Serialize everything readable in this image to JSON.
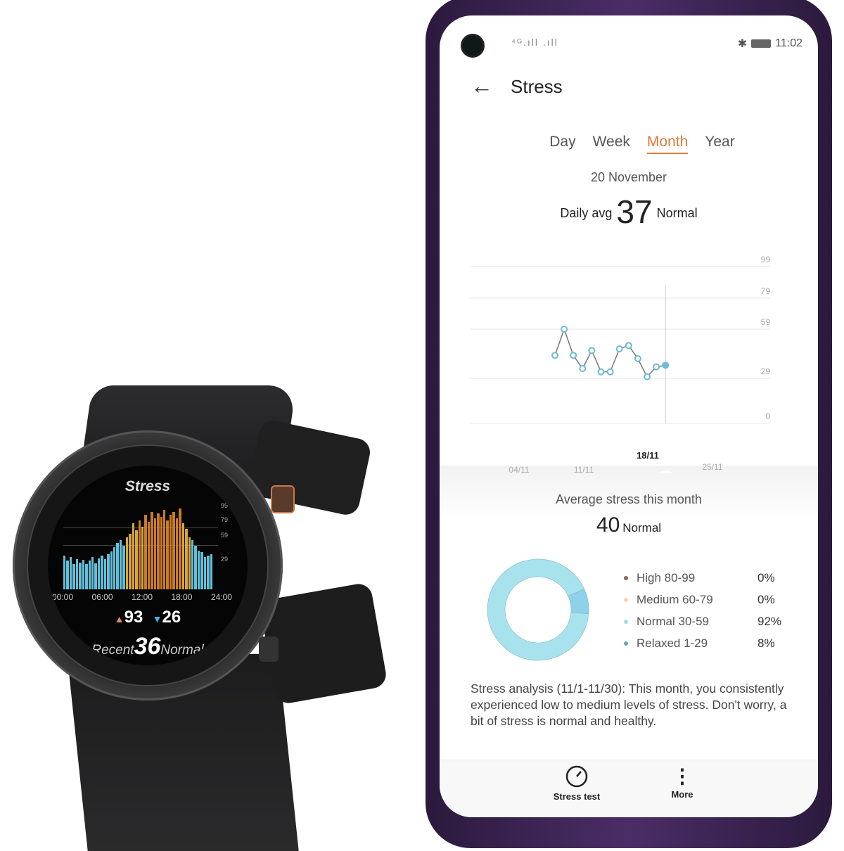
{
  "watch": {
    "title": "Stress",
    "y_labels": [
      "99",
      "79",
      "59",
      "29"
    ],
    "x_labels": [
      "00:00",
      "06:00",
      "12:00",
      "18:00",
      "24:00"
    ],
    "max": "93",
    "min": "26",
    "recent_label": "Recent",
    "recent_value": "36",
    "recent_level": "Normal",
    "bars": [
      40,
      34,
      38,
      30,
      36,
      32,
      35,
      30,
      34,
      38,
      31,
      37,
      40,
      36,
      42,
      45,
      50,
      55,
      58,
      52,
      62,
      66,
      78,
      70,
      82,
      74,
      88,
      80,
      92,
      84,
      90,
      86,
      94,
      82,
      88,
      92,
      84,
      96,
      78,
      72,
      62,
      58,
      52,
      46,
      44,
      38,
      40,
      42
    ],
    "colors": {
      "relaxed": "#2aa8e0",
      "normal": "#6fd3ee",
      "medium": "#f0b840",
      "high": "#e0882a"
    }
  },
  "status_bar": {
    "signal": "⁴ᴳ.ıll .ıll",
    "time": "11:02"
  },
  "header": {
    "title": "Stress"
  },
  "tabs": [
    {
      "label": "Day"
    },
    {
      "label": "Week"
    },
    {
      "label": "Month",
      "active": true
    },
    {
      "label": "Year"
    }
  ],
  "summary": {
    "date": "20 November",
    "label": "Daily avg",
    "value": "37",
    "level": "Normal"
  },
  "chart_data": {
    "type": "line",
    "x": [
      "08/11",
      "09/11",
      "10/11",
      "11/11",
      "12/11",
      "13/11",
      "14/11",
      "15/11",
      "16/11",
      "17/11",
      "18/11",
      "19/11",
      "20/11"
    ],
    "values": [
      43,
      59,
      43,
      35,
      46,
      33,
      33,
      47,
      49,
      41,
      30,
      36,
      37
    ],
    "y_ticks": [
      99,
      79,
      59,
      29,
      0
    ],
    "x_tick_labels": [
      "04/11",
      "11/11",
      "18/11",
      "25/11"
    ],
    "selected_x_label": "18/11",
    "x_range_days": [
      "01/11",
      "30/11"
    ],
    "grid": true,
    "color": "#6cbcd0"
  },
  "month": {
    "title": "Average stress this month",
    "value": "40",
    "level": "Normal",
    "distribution": [
      {
        "label": "High 80-99",
        "pct": "0%",
        "value": 0,
        "color": "#8a6a55"
      },
      {
        "label": "Medium 60-79",
        "pct": "0%",
        "value": 0,
        "color": "#f3d8a8"
      },
      {
        "label": "Normal 30-59",
        "pct": "92%",
        "value": 92,
        "color": "#a8e2ec"
      },
      {
        "label": "Relaxed 1-29",
        "pct": "8%",
        "value": 8,
        "color": "#8fd0ea"
      }
    ]
  },
  "analysis": "Stress analysis (11/1-11/30): This month, you consistently experienced low to medium levels of stress. Don't worry, a bit of stress is normal and healthy.",
  "bottom_nav": [
    {
      "label": "Stress test",
      "icon": "gauge-icon"
    },
    {
      "label": "More",
      "icon": "more-vertical-icon"
    }
  ]
}
